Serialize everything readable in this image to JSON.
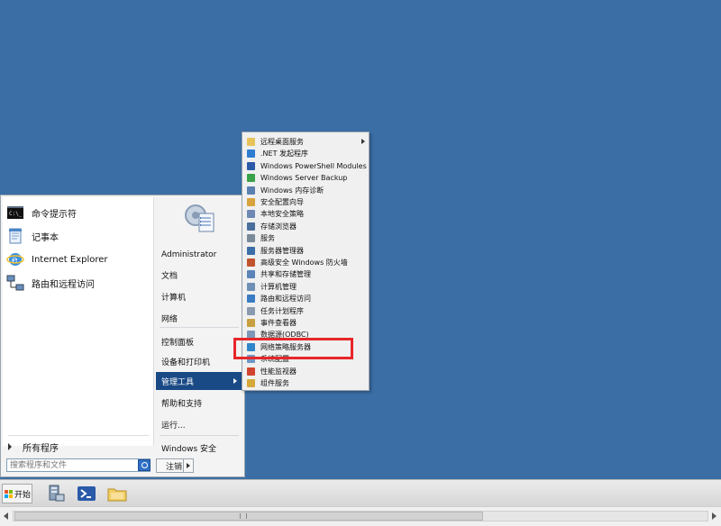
{
  "start_menu": {
    "pinned": [
      {
        "label": "命令提示符",
        "icon": "cmd-icon"
      },
      {
        "label": "记事本",
        "icon": "notepad-icon"
      },
      {
        "label": "Internet Explorer",
        "icon": "ie-icon"
      },
      {
        "label": "路由和远程访问",
        "icon": "network-icon"
      }
    ],
    "all_programs_label": "所有程序",
    "search_placeholder": "搜索程序和文件",
    "right_items": [
      {
        "label": "Administrator"
      },
      {
        "label": "文档"
      },
      {
        "label": "计算机"
      },
      {
        "label": "网络"
      },
      {
        "label": "控制面板"
      },
      {
        "label": "设备和打印机"
      },
      {
        "label": "管理工具"
      },
      {
        "label": "帮助和支持"
      },
      {
        "label": "运行..."
      },
      {
        "label": "Windows 安全"
      }
    ],
    "logoff_label": "注销"
  },
  "admin_tools_submenu": {
    "items": [
      {
        "label": "远程桌面服务",
        "icon": "folder-icon",
        "color": "#e8c35a"
      },
      {
        "label": ".NET 发起程序",
        "icon": "dotnet-icon",
        "color": "#2e7dd1"
      },
      {
        "label": "Windows PowerShell Modules",
        "icon": "powershell-icon",
        "color": "#2a5aa8"
      },
      {
        "label": "Windows Server Backup",
        "icon": "backup-icon",
        "color": "#3ba04a"
      },
      {
        "label": "Windows 内存诊断",
        "icon": "memory-icon",
        "color": "#5a7fb0"
      },
      {
        "label": "安全配置向导",
        "icon": "security-icon",
        "color": "#d8a33c"
      },
      {
        "label": "本地安全策略",
        "icon": "policy-icon",
        "color": "#6d88b3"
      },
      {
        "label": "存储浏览器",
        "icon": "storage-icon",
        "color": "#4a6f9c"
      },
      {
        "label": "服务",
        "icon": "services-icon",
        "color": "#7a8a99"
      },
      {
        "label": "服务器管理器",
        "icon": "server-manager-icon",
        "color": "#3c6fa8"
      },
      {
        "label": "高级安全 Windows 防火墙",
        "icon": "firewall-icon",
        "color": "#c0532d"
      },
      {
        "label": "共享和存储管理",
        "icon": "share-icon",
        "color": "#5b84b8"
      },
      {
        "label": "计算机管理",
        "icon": "computer-management-icon",
        "color": "#6f8fb5"
      },
      {
        "label": "路由和远程访问",
        "icon": "routing-icon",
        "color": "#3b7bc4"
      },
      {
        "label": "任务计划程序",
        "icon": "scheduler-icon",
        "color": "#8a9bb0"
      },
      {
        "label": "事件查看器",
        "icon": "event-viewer-icon",
        "color": "#c9a040"
      },
      {
        "label": "数据源(ODBC)",
        "icon": "odbc-icon",
        "color": "#7d97b8"
      },
      {
        "label": "网络策略服务器",
        "icon": "nps-icon",
        "color": "#2f86c9"
      },
      {
        "label": "系统配置",
        "icon": "msconfig-icon",
        "color": "#6f96c4"
      },
      {
        "label": "性能监视器",
        "icon": "perfmon-icon",
        "color": "#d0442f"
      },
      {
        "label": "组件服务",
        "icon": "component-services-icon",
        "color": "#d6a83a"
      }
    ]
  },
  "taskbar": {
    "start_label": "开始",
    "pinned": [
      {
        "icon": "server-manager-icon"
      },
      {
        "icon": "powershell-icon"
      },
      {
        "icon": "explorer-folder-icon"
      }
    ]
  },
  "colors": {
    "desktop": "#3a6ea5",
    "menu_highlight": "#1a4a86",
    "annotation_red": "#e8262a"
  }
}
